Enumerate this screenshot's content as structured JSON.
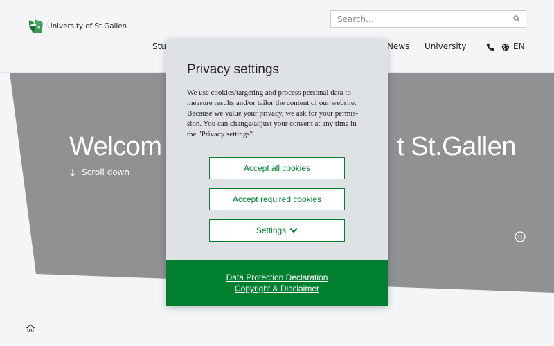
{
  "header": {
    "logo_text": "University of St.Gallen",
    "search_placeholder": "Search...",
    "nav": {
      "studies": "Stud",
      "news": "News",
      "university": "University"
    },
    "language": "EN"
  },
  "hero": {
    "title_left": "Welcom",
    "title_right": "t St.Gallen",
    "scroll_label": "Scroll down"
  },
  "dialog": {
    "title": "Privacy settings",
    "body_lines": [
      "We use cookies/targeting and process personal data to",
      "measure results and/or tailor the content of our website.",
      "Because we value your privacy, we ask for your permis-",
      "sion. You can change/adjust your consent at any time in",
      "the \"Privacy settings\"."
    ],
    "accept_all": "Accept all cookies",
    "accept_required": "Accept required cookies",
    "settings": "Settings",
    "links": {
      "data_protection": "Data Protection Declaration",
      "copyright": "Copyright & Disclaimer"
    }
  },
  "colors": {
    "brand_green": "#00802f",
    "hero_gray": "#909193",
    "dialog_bg": "#dfe2e5",
    "page_bg": "#f4f5f7"
  },
  "icons": [
    "logo-mark",
    "search-icon",
    "phone-icon",
    "globe-icon",
    "arrow-down-icon",
    "pause-icon",
    "chevron-down-icon",
    "home-icon"
  ]
}
